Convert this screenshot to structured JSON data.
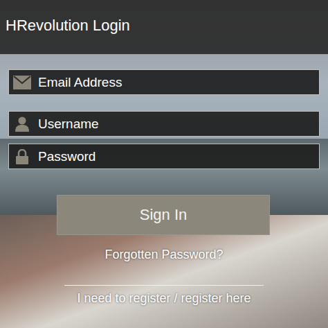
{
  "window": {
    "title": "HRevolution Login"
  },
  "fields": [
    {
      "kind": "email",
      "placeholder": "Email Address"
    },
    {
      "kind": "username",
      "placeholder": "Username"
    },
    {
      "kind": "password",
      "placeholder": "Password"
    }
  ],
  "buttons": [
    "Sign In"
  ],
  "links": {
    "forgot": "Forgotten Password?",
    "register": "I need to register / register here"
  }
}
